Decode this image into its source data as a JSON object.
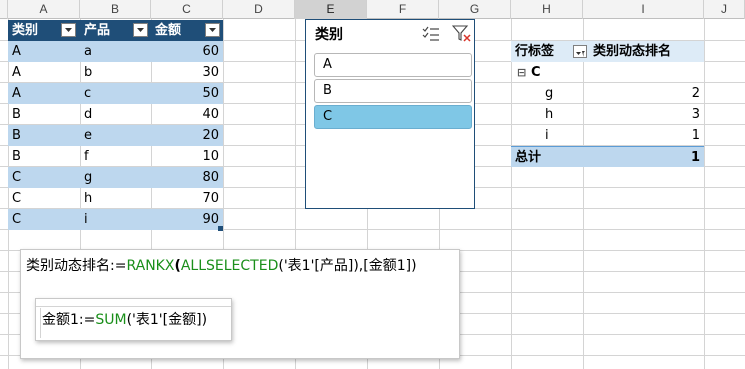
{
  "columns": [
    "A",
    "B",
    "C",
    "D",
    "E",
    "F",
    "G",
    "H",
    "I",
    "J"
  ],
  "table": {
    "headers": [
      "类别",
      "产品",
      "金额"
    ],
    "rows": [
      [
        "A",
        "a",
        "60"
      ],
      [
        "A",
        "b",
        "30"
      ],
      [
        "A",
        "c",
        "50"
      ],
      [
        "B",
        "d",
        "40"
      ],
      [
        "B",
        "e",
        "20"
      ],
      [
        "B",
        "f",
        "10"
      ],
      [
        "C",
        "g",
        "80"
      ],
      [
        "C",
        "h",
        "70"
      ],
      [
        "C",
        "i",
        "90"
      ]
    ]
  },
  "slicer": {
    "title": "类别",
    "items": [
      "A",
      "B",
      "C"
    ],
    "selected": "C",
    "icons": [
      "multi-select-icon",
      "clear-filter-icon"
    ]
  },
  "pivot": {
    "row_label_header": "行标签",
    "value_header": "类别动态排名",
    "group": {
      "toggle": "⊟",
      "name": "C"
    },
    "rows": [
      {
        "label": "g",
        "value": "2"
      },
      {
        "label": "h",
        "value": "3"
      },
      {
        "label": "i",
        "value": "1"
      }
    ],
    "total": {
      "label": "总计",
      "value": "1"
    }
  },
  "measures": {
    "rank": {
      "name": "类别动态排名:=",
      "fn1": "RANKX",
      "p1": "(",
      "fn2": "ALLSELECTED",
      "rest": "('表1'[产品]),[金额1])"
    },
    "sum": {
      "name": "金额1:=",
      "fn": "SUM",
      "rest": "('表1'[金额])"
    }
  },
  "colors": {
    "table_header": "#1f4e78",
    "band_blue": "#bdd7ee",
    "band_light": "#ddebf7",
    "slicer_selected": "#7fc7e6",
    "dax_function": "#1a8f1a"
  }
}
